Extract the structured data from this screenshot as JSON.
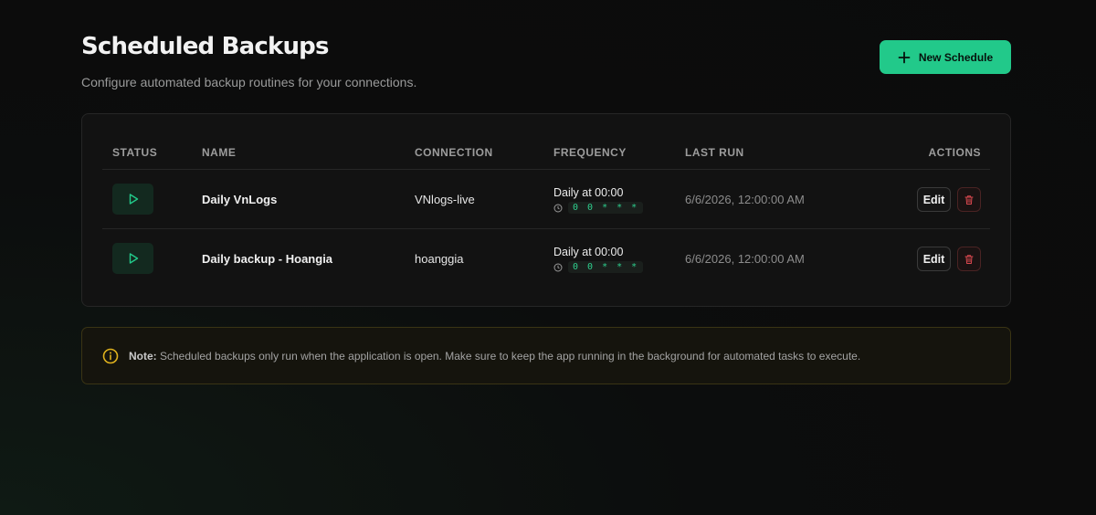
{
  "header": {
    "title": "Scheduled Backups",
    "subtitle": "Configure automated backup routines for your connections."
  },
  "new_button": {
    "label": "New Schedule",
    "icon": "plus-icon"
  },
  "table": {
    "columns": [
      "STATUS",
      "NAME",
      "CONNECTION",
      "FREQUENCY",
      "LAST RUN",
      "ACTIONS"
    ],
    "rows": [
      {
        "status_icon": "play-icon",
        "name": "Daily VnLogs",
        "connection": "VNlogs-live",
        "frequency": "Daily at 00:00",
        "cron": "0 0 * * *",
        "last_run": "6/6/2026, 12:00:00 AM",
        "edit_label": "Edit",
        "delete_icon": "trash-icon"
      },
      {
        "status_icon": "play-icon",
        "name": "Daily backup - Hoangia",
        "connection": "hoanggia",
        "frequency": "Daily at 00:00",
        "cron": "0 0 * * *",
        "last_run": "6/6/2026, 12:00:00 AM",
        "edit_label": "Edit",
        "delete_icon": "trash-icon"
      }
    ]
  },
  "note": {
    "icon": "info-icon",
    "label": "Note:",
    "text": " Scheduled backups only run when the application is open. Make sure to keep the app running in the background for automated tasks to execute."
  },
  "colors": {
    "accent": "#22c98a",
    "background": "#0b0b0b",
    "card": "#121212",
    "warning": "#e0b21d",
    "danger": "#d9484f"
  }
}
